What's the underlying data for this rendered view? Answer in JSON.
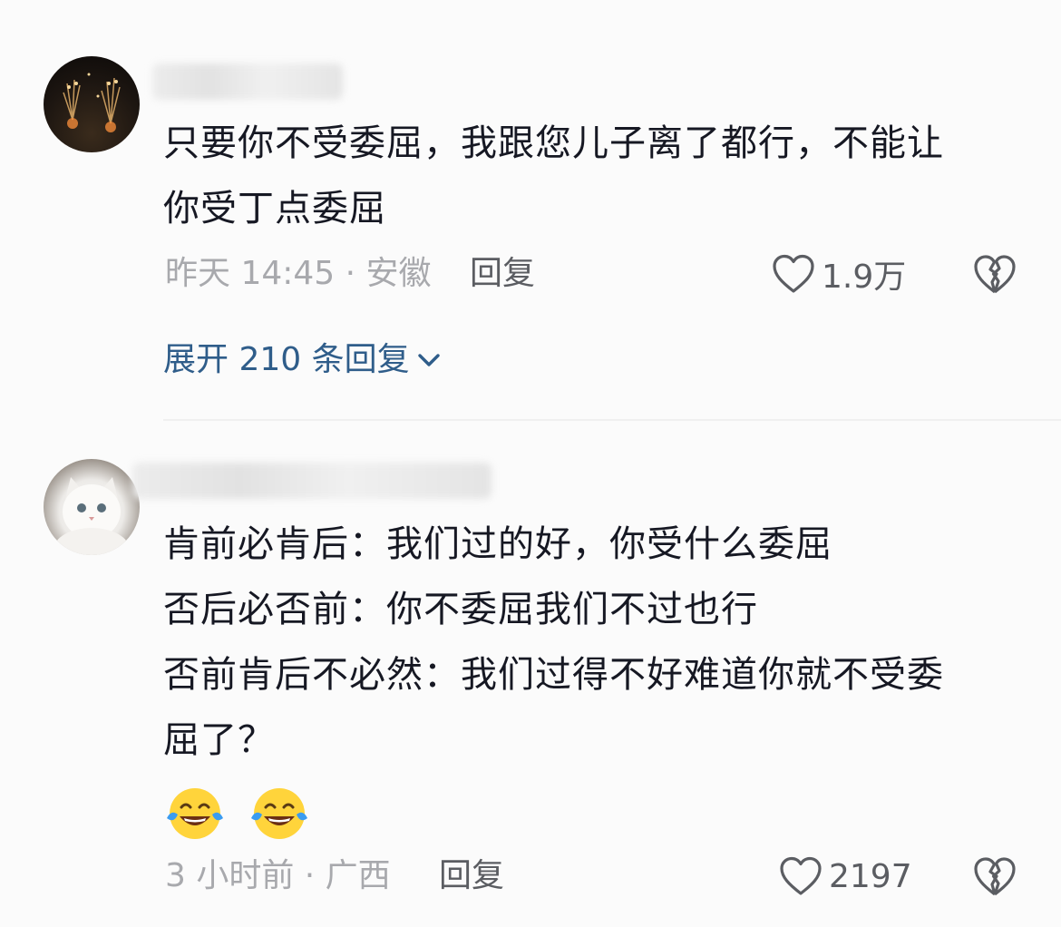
{
  "comments": [
    {
      "avatar_icon": "fireworks-avatar",
      "lines": [
        "只要你不受委屈，我跟您儿子离了都行，不能让",
        "你受丁点委屈"
      ],
      "meta": "昨天 14:45 · 安徽",
      "reply_label": "回复",
      "like_count": "1.9万",
      "expand_label": "展开 210 条回复"
    },
    {
      "avatar_icon": "white-cat-avatar",
      "lines": [
        "肯前必肯后：我们过的好，你受什么委屈",
        "否后必否前：你不委屈我们不过也行",
        "否前肯后不必然：我们过得不好难道你就不受委",
        "屈了？"
      ],
      "emojis": [
        "laughing-tears-emoji",
        "laughing-tears-emoji"
      ],
      "meta": "3 小时前 · 广西",
      "reply_label": "回复",
      "like_count": "2197"
    }
  ],
  "colors": {
    "text": "#161823",
    "meta": "#a8a9ad",
    "link": "#2f5d8a",
    "icon": "#5b5d62"
  }
}
